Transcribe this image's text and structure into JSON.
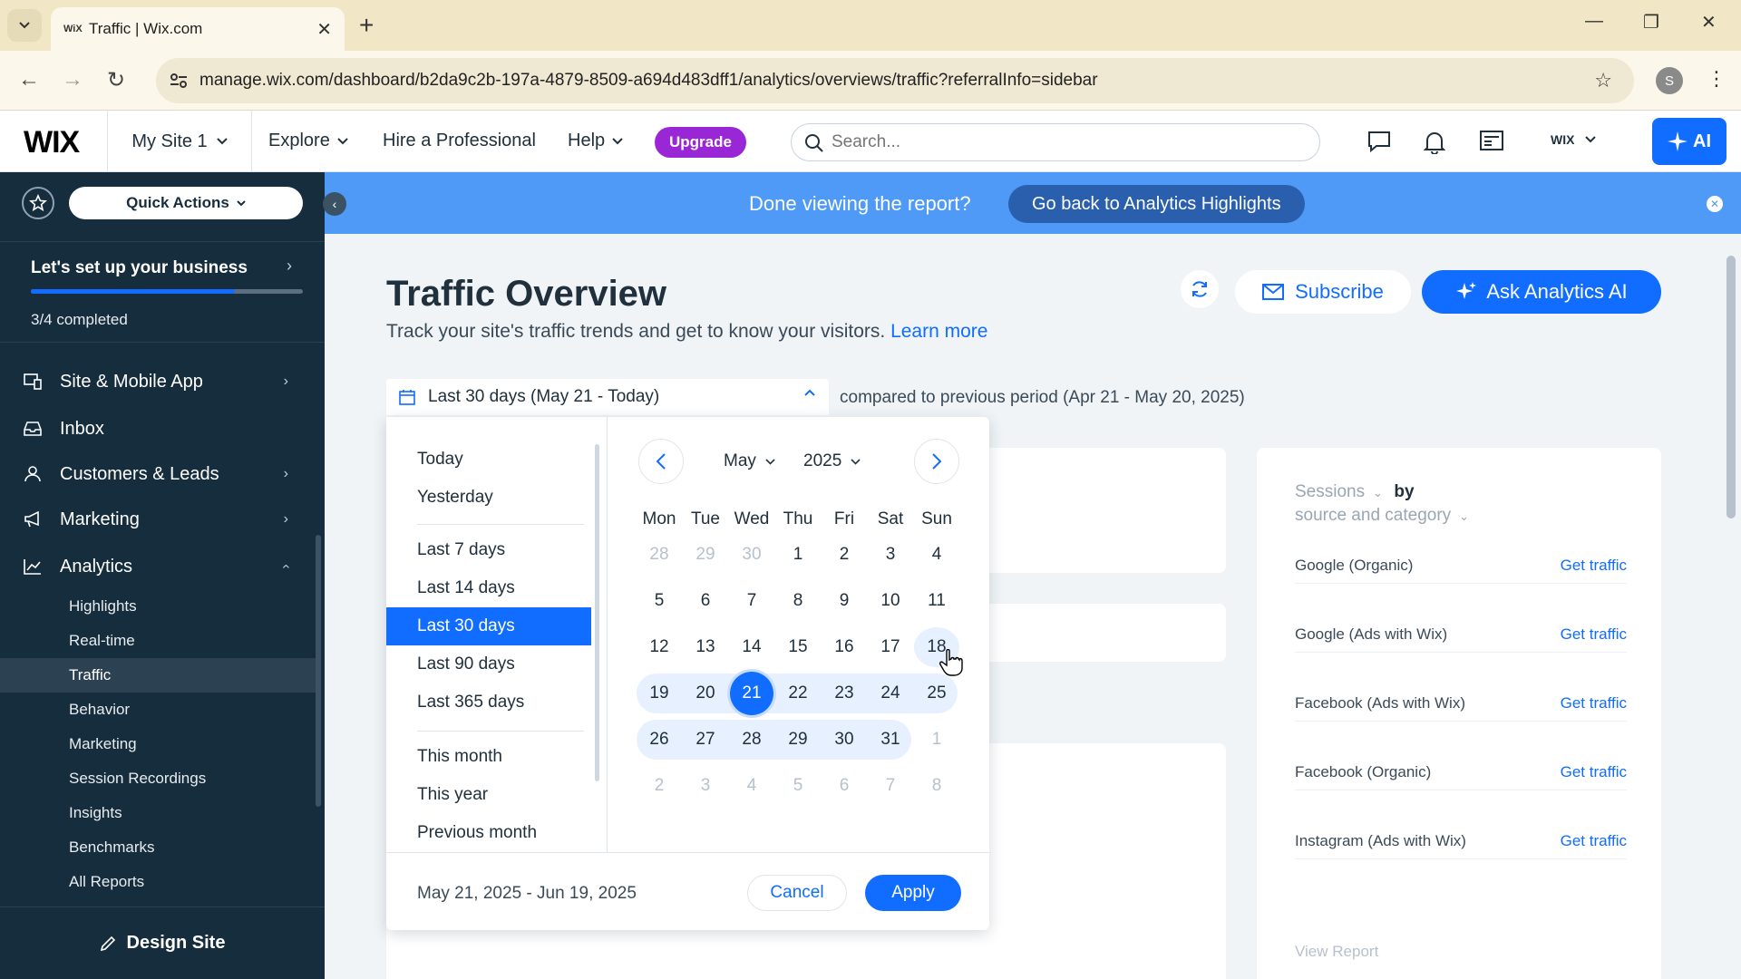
{
  "browser": {
    "tab_title": "Traffic | Wix.com",
    "tab_favicon": "WiX",
    "url": "manage.wix.com/dashboard/b2da9c2b-197a-4879-8509-a694d483dff1/analytics/overviews/traffic?referralInfo=sidebar",
    "profile_initial": "S"
  },
  "topbar": {
    "logo": "WIX",
    "site_name": "My Site 1",
    "nav": {
      "explore": "Explore",
      "hire": "Hire a Professional",
      "help": "Help"
    },
    "upgrade": "Upgrade",
    "search_placeholder": "Search...",
    "account_label": "WIX",
    "ai_label": "AI"
  },
  "sidebar": {
    "quick_actions": "Quick Actions",
    "setup_title": "Let's set up your business",
    "setup_status": "3/4 completed",
    "setup_progress": 0.75,
    "items": [
      {
        "label": "Site & Mobile App",
        "icon": "site-icon"
      },
      {
        "label": "Inbox",
        "icon": "inbox-icon"
      },
      {
        "label": "Customers & Leads",
        "icon": "customers-icon"
      },
      {
        "label": "Marketing",
        "icon": "megaphone-icon"
      },
      {
        "label": "Analytics",
        "icon": "analytics-icon"
      }
    ],
    "analytics_sub": [
      "Highlights",
      "Real-time",
      "Traffic",
      "Behavior",
      "Marketing",
      "Session Recordings",
      "Insights",
      "Benchmarks",
      "All Reports"
    ],
    "active_sub": "Traffic",
    "design_site": "Design Site"
  },
  "banner": {
    "text": "Done viewing the report?",
    "button": "Go back to Analytics Highlights"
  },
  "page": {
    "title": "Traffic Overview",
    "subtitle": "Track your site's traffic trends and get to know your visitors.",
    "learn_more": "Learn more",
    "subscribe": "Subscribe",
    "ask_ai": "Ask Analytics AI",
    "date_range_label": "Last 30 days (May 21 - Today)",
    "compared": "compared to previous period (Apr 21 - May 20, 2025)"
  },
  "picker": {
    "presets": [
      "Today",
      "Yesterday",
      "Last 7 days",
      "Last 14 days",
      "Last 30 days",
      "Last 90 days",
      "Last 365 days",
      "This month",
      "This year",
      "Previous month"
    ],
    "active_preset": "Last 30 days",
    "month": "May",
    "year": "2025",
    "weekdays": [
      "Mon",
      "Tue",
      "Wed",
      "Thu",
      "Fri",
      "Sat",
      "Sun"
    ],
    "weeks": [
      [
        "28",
        "29",
        "30",
        "1",
        "2",
        "3",
        "4"
      ],
      [
        "5",
        "6",
        "7",
        "8",
        "9",
        "10",
        "11"
      ],
      [
        "12",
        "13",
        "14",
        "15",
        "16",
        "17",
        "18"
      ],
      [
        "19",
        "20",
        "21",
        "22",
        "23",
        "24",
        "25"
      ],
      [
        "26",
        "27",
        "28",
        "29",
        "30",
        "31",
        "1"
      ],
      [
        "2",
        "3",
        "4",
        "5",
        "6",
        "7",
        "8"
      ]
    ],
    "selected_day": "21",
    "hovered_day": "18",
    "range_text": "May 21, 2025 - Jun 19, 2025",
    "cancel": "Cancel",
    "apply": "Apply"
  },
  "sessions_card": {
    "metric": "Sessions",
    "by": "by",
    "dimension": "source and category",
    "rows": [
      {
        "source": "Google (Organic)",
        "action": "Get traffic"
      },
      {
        "source": "Google (Ads with Wix)",
        "action": "Get traffic"
      },
      {
        "source": "Facebook (Ads with Wix)",
        "action": "Get traffic"
      },
      {
        "source": "Facebook (Organic)",
        "action": "Get traffic"
      },
      {
        "source": "Instagram (Ads with Wix)",
        "action": "Get traffic"
      }
    ],
    "view_report": "View Report"
  },
  "colors": {
    "accent": "#116dff",
    "sidebar": "#162d3d",
    "banner": "#4e9af6",
    "upgrade": "#9a27d5"
  }
}
